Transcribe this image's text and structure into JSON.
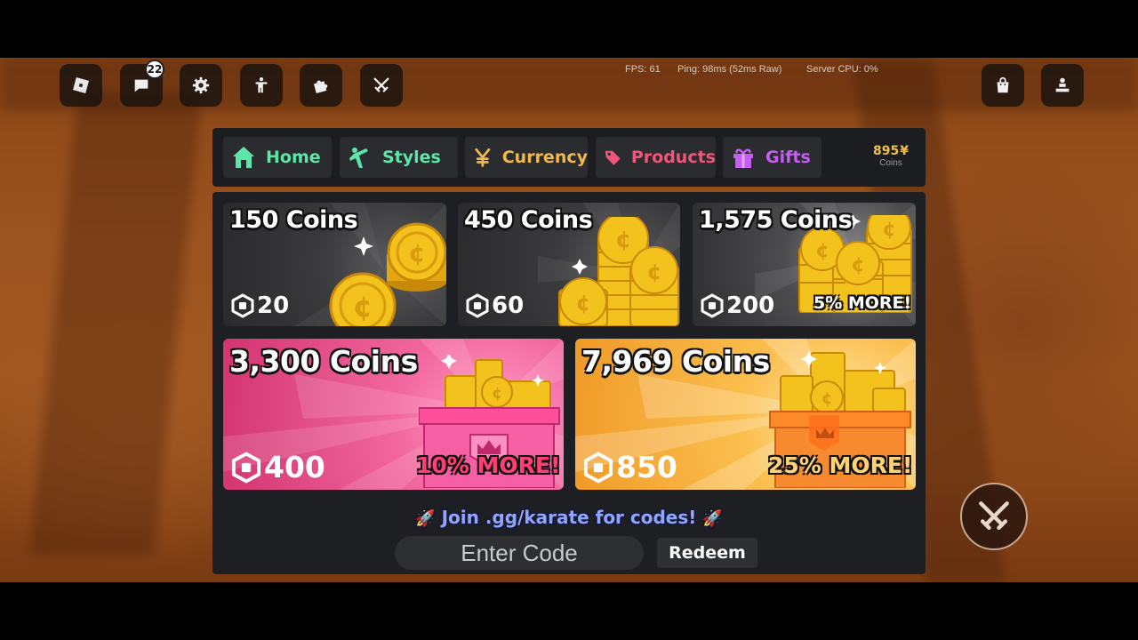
{
  "top_bar": {
    "chat_badge": "22",
    "icons": [
      "roblox-menu-icon",
      "chat-icon",
      "settings-icon",
      "emote-icon",
      "puzzle-icon",
      "swords-icon"
    ]
  },
  "stats": {
    "fps": "FPS: 61",
    "ping": "Ping: 98ms (52ms Raw)",
    "server_cpu": "Server CPU: 0%"
  },
  "tabs": [
    {
      "label": "Home",
      "color": "#5ee6a8",
      "icon": "home-icon"
    },
    {
      "label": "Styles",
      "color": "#5ee6a8",
      "icon": "karate-kick-icon"
    },
    {
      "label": "Currency",
      "color": "#f1b84a",
      "icon": "yen-icon"
    },
    {
      "label": "Products",
      "color": "#f2557a",
      "icon": "tag-icon"
    },
    {
      "label": "Gifts",
      "color": "#c45ef0",
      "icon": "gift-icon"
    }
  ],
  "coins": {
    "amount": "895",
    "symbol": "¥",
    "label": "Coins"
  },
  "packs": [
    {
      "title": "150 Coins",
      "price": "20",
      "bonus": ""
    },
    {
      "title": "450 Coins",
      "price": "60",
      "bonus": ""
    },
    {
      "title": "1,575 Coins",
      "price": "200",
      "bonus": "5% MORE!"
    },
    {
      "title": "3,300 Coins",
      "price": "400",
      "bonus": "10% MORE!"
    },
    {
      "title": "7,969 Coins",
      "price": "850",
      "bonus": "25% MORE!"
    }
  ],
  "promo": {
    "text": "Join .gg/karate for codes!"
  },
  "code_input": {
    "placeholder": "Enter Code",
    "value": ""
  },
  "redeem": {
    "label": "Redeem"
  },
  "right_buttons": [
    "shop-bag-icon",
    "avatar-pedestal-icon"
  ],
  "combat_button": "crossed-swords-icon"
}
